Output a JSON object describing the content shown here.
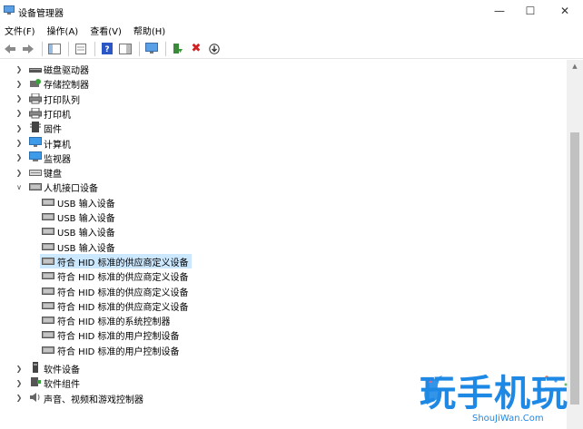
{
  "window": {
    "title": "设备管理器"
  },
  "menu": [
    "文件(F)",
    "操作(A)",
    "查看(V)",
    "帮助(H)"
  ],
  "tree": {
    "items": [
      {
        "label": "磁盘驱动器",
        "icon": "disk-icon"
      },
      {
        "label": "存储控制器",
        "icon": "storage-icon"
      },
      {
        "label": "打印队列",
        "icon": "printer-icon"
      },
      {
        "label": "打印机",
        "icon": "printer-icon"
      },
      {
        "label": "固件",
        "icon": "firmware-icon"
      },
      {
        "label": "计算机",
        "icon": "computer-icon"
      },
      {
        "label": "监视器",
        "icon": "monitor-icon"
      },
      {
        "label": "键盘",
        "icon": "keyboard-icon"
      },
      {
        "label": "人机接口设备",
        "icon": "hid-icon"
      },
      {
        "label": "USB 输入设备",
        "icon": "hid-icon"
      },
      {
        "label": "USB 输入设备",
        "icon": "hid-icon"
      },
      {
        "label": "USB 输入设备",
        "icon": "hid-icon"
      },
      {
        "label": "USB 输入设备",
        "icon": "hid-icon"
      },
      {
        "label": "符合 HID 标准的供应商定义设备",
        "icon": "hid-icon"
      },
      {
        "label": "符合 HID 标准的供应商定义设备",
        "icon": "hid-icon"
      },
      {
        "label": "符合 HID 标准的供应商定义设备",
        "icon": "hid-icon"
      },
      {
        "label": "符合 HID 标准的供应商定义设备",
        "icon": "hid-icon"
      },
      {
        "label": "符合 HID 标准的系统控制器",
        "icon": "hid-icon"
      },
      {
        "label": "符合 HID 标准的用户控制设备",
        "icon": "hid-icon"
      },
      {
        "label": "符合 HID 标准的用户控制设备",
        "icon": "hid-icon"
      },
      {
        "label": "软件设备",
        "icon": "software-device-icon"
      },
      {
        "label": "软件组件",
        "icon": "software-component-icon"
      },
      {
        "label": "声音、视频和游戏控制器",
        "icon": "speaker-icon"
      }
    ]
  },
  "watermark": {
    "brand": "玩手机玩",
    "site": "ShouJiWan.Com"
  },
  "colors": {
    "selection": "#cce8ff",
    "accent": "#1e88e5"
  }
}
